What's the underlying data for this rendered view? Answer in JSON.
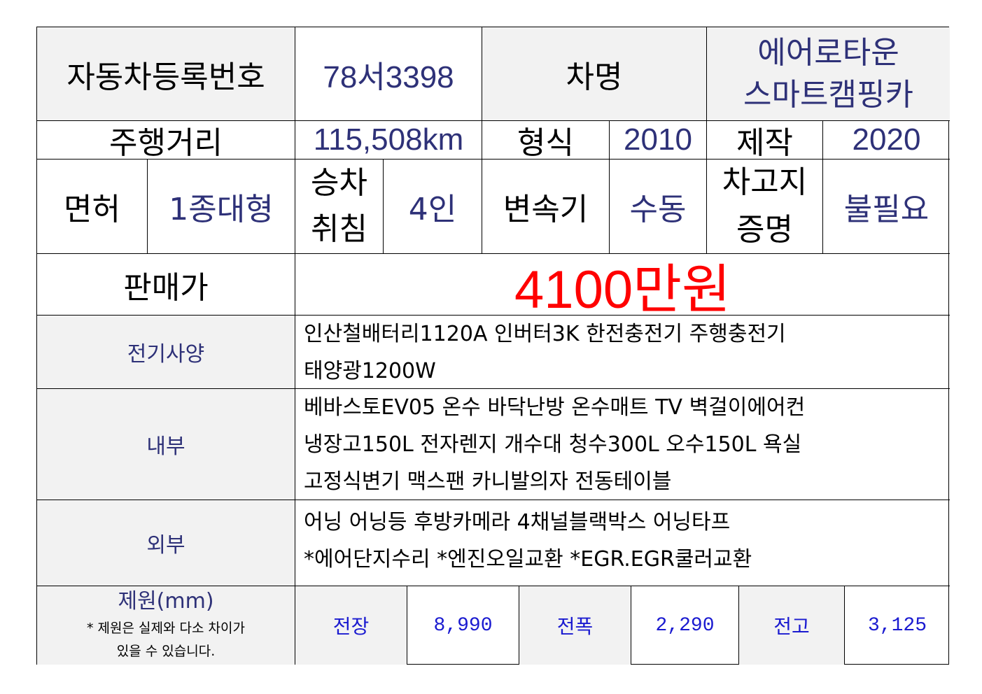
{
  "row1": {
    "reg_label": "자동차등록번호",
    "reg_value": "78서3398",
    "name_label": "차명",
    "name_value_line1": "에어로타운",
    "name_value_line2": "스마트캠핑카"
  },
  "row2": {
    "mileage_label": "주행거리",
    "mileage_value": "115,508km",
    "model_label": "형식",
    "model_value": "2010",
    "made_label": "제작",
    "made_value": "2020"
  },
  "row3": {
    "license_label": "면허",
    "license_value": "1종대형",
    "seats_label_line1": "승차",
    "seats_label_line2": "취침",
    "seats_value": "4인",
    "trans_label": "변속기",
    "trans_value": "수동",
    "garage_label_line1": "차고지",
    "garage_label_line2": "증명",
    "garage_value": "불필요"
  },
  "row4": {
    "price_label": "판매가",
    "price_value": "4100만원"
  },
  "electric": {
    "label": "전기사양",
    "lines": [
      "인산철배터리1120A 인버터3K 한전충전기 주행충전기",
      "태양광1200W"
    ]
  },
  "interior": {
    "label": "내부",
    "lines": [
      "베바스토EV05 온수 바닥난방 온수매트 TV 벽걸이에어컨",
      "냉장고150L 전자렌지 개수대 청수300L 오수150L 욕실",
      "고정식변기 맥스팬 카니발의자 전동테이블"
    ]
  },
  "exterior": {
    "label": "외부",
    "lines": [
      "어닝 어닝등 후방카메라 4채널블랙박스 어닝타프",
      "*에어단지수리 *엔진오일교환 *EGR.EGR쿨러교환"
    ]
  },
  "dimensions": {
    "label": "제원(mm)",
    "note_line1": "* 제원은 실제와 다소 차이가",
    "note_line2": "있을 수 있습니다.",
    "length_label": "전장",
    "length_value": "8,990",
    "width_label": "전폭",
    "width_value": "2,290",
    "height_label": "전고",
    "height_value": "3,125"
  },
  "colors": {
    "label_bg": "#f2f2f2",
    "value_navy": "#2e3178",
    "spec_blue": "#1a1ad0",
    "price_red": "#ff0000",
    "border": "#000000"
  }
}
